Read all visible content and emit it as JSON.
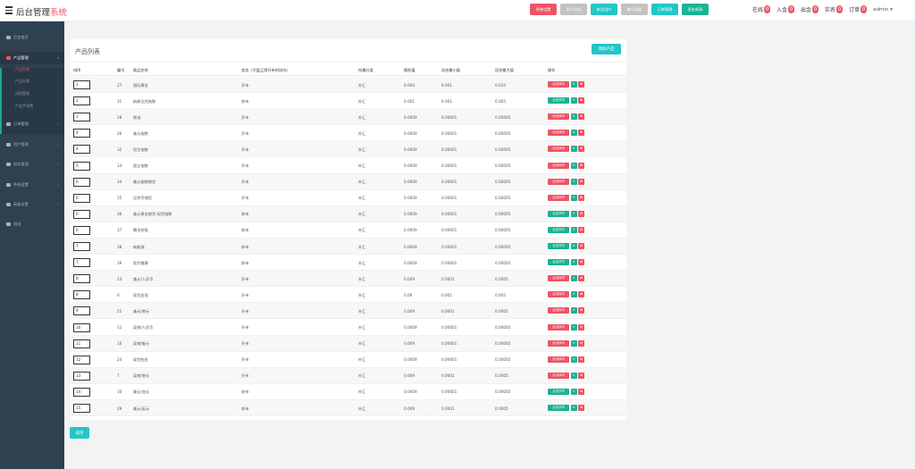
{
  "header": {
    "brand_main": "后台管理",
    "brand_accent": "系统",
    "buttons": [
      {
        "label": "系统设置",
        "color": "#ed5565"
      },
      {
        "label": "用户列表",
        "color": "#c2c2c2"
      },
      {
        "label": "新注用户",
        "color": "#23c6c8"
      },
      {
        "label": "账号出款",
        "color": "#c2c2c2"
      },
      {
        "label": "订单管理",
        "color": "#23c6c8"
      },
      {
        "label": "资金报表",
        "color": "#1ab394"
      }
    ],
    "stats": [
      {
        "label": "在线",
        "count": "0"
      },
      {
        "label": "入金",
        "count": "0"
      },
      {
        "label": "出金",
        "count": "0"
      },
      {
        "label": "实名",
        "count": "0"
      },
      {
        "label": "订单",
        "count": "0"
      }
    ],
    "user": "admin"
  },
  "sidebar": {
    "items": [
      {
        "label": "后台首页"
      },
      {
        "label": "产品管理"
      },
      {
        "label": "订单管理"
      },
      {
        "label": "用户管理"
      },
      {
        "label": "财务管理"
      },
      {
        "label": "系统设置"
      },
      {
        "label": "高级设置"
      },
      {
        "label": "退出"
      }
    ],
    "subitems": [
      {
        "label": "产品列表"
      },
      {
        "label": "产品分类"
      },
      {
        "label": "风控管理"
      },
      {
        "label": "产品手续费"
      }
    ]
  },
  "panel": {
    "title": "产品列表",
    "add_label": "添加产品",
    "sort_label": "排序"
  },
  "table": {
    "headers": [
      "排序",
      "编号",
      "商品名称",
      "状态（大盘正常开市时间内）",
      "所属分类",
      "随机值",
      "风控最小值",
      "风控最大值",
      "操作"
    ],
    "toggle_open": "点击开市",
    "toggle_close": "点击休市",
    "rows": [
      {
        "sort": "1",
        "id": "27",
        "name": "国际黄金",
        "status": "开市",
        "category": "外汇",
        "rand": "0.004",
        "min": "0.001",
        "max": "0.010",
        "open": false
      },
      {
        "sort": "2",
        "id": "31",
        "name": "纳斯达克指数",
        "status": "休市",
        "category": "外汇",
        "rand": "0.001",
        "min": "0.001",
        "max": "0.005",
        "open": true
      },
      {
        "sort": "3",
        "id": "28",
        "name": "原油",
        "status": "开市",
        "category": "外汇",
        "rand": "0.0009",
        "min": "0.00001",
        "max": "0.00005",
        "open": false
      },
      {
        "sort": "4",
        "id": "26",
        "name": "美元指数",
        "status": "开市",
        "category": "外汇",
        "rand": "0.0009",
        "min": "0.00001",
        "max": "0.00005",
        "open": false
      },
      {
        "sort": "4",
        "id": "32",
        "name": "恒生指数",
        "status": "开市",
        "category": "外汇",
        "rand": "0.0009",
        "min": "0.00001",
        "max": "0.00005",
        "open": false
      },
      {
        "sort": "5",
        "id": "33",
        "name": "国企指数",
        "status": "开市",
        "category": "外汇",
        "rand": "0.0009",
        "min": "0.00001",
        "max": "0.00005",
        "open": false
      },
      {
        "sort": "6",
        "id": "34",
        "name": "美元指数期货",
        "status": "开市",
        "category": "外汇",
        "rand": "0.0009",
        "min": "0.00001",
        "max": "0.00005",
        "open": false
      },
      {
        "sort": "6",
        "id": "35",
        "name": "比特币期货",
        "status": "开市",
        "category": "外汇",
        "rand": "0.0009",
        "min": "0.00001",
        "max": "0.00005",
        "open": false
      },
      {
        "sort": "6",
        "id": "36",
        "name": "美元黄金期货-现货指数",
        "status": "休市",
        "category": "外汇",
        "rand": "0.0009",
        "min": "0.00001",
        "max": "0.00005",
        "open": true
      },
      {
        "sort": "6",
        "id": "37",
        "name": "腾讯控股",
        "status": "休市",
        "category": "外汇",
        "rand": "0.0009",
        "min": "0.00001",
        "max": "0.00005",
        "open": true
      },
      {
        "sort": "7",
        "id": "38",
        "name": "新能源",
        "status": "休市",
        "category": "外汇",
        "rand": "0.0009",
        "min": "0.00001",
        "max": "0.00005",
        "open": true
      },
      {
        "sort": "7",
        "id": "39",
        "name": "医疗健康",
        "status": "休市",
        "category": "外汇",
        "rand": "0.0009",
        "min": "0.00001",
        "max": "0.00005",
        "open": true
      },
      {
        "sort": "8",
        "id": "23",
        "name": "美元/人民币",
        "status": "开市",
        "category": "外汇",
        "rand": "0.009",
        "min": "0.0001",
        "max": "0.0005",
        "open": false
      },
      {
        "sort": "8",
        "id": "6",
        "name": "现货白银",
        "status": "开市",
        "category": "外汇",
        "rand": "0.09",
        "min": "0.001",
        "max": "0.005",
        "open": false
      },
      {
        "sort": "9",
        "id": "25",
        "name": "美元/港元",
        "status": "开市",
        "category": "外汇",
        "rand": "0.009",
        "min": "0.0001",
        "max": "0.0005",
        "open": false
      },
      {
        "sort": "10",
        "id": "11",
        "name": "英镑/人民币",
        "status": "开市",
        "category": "外汇",
        "rand": "0.0009",
        "min": "0.00001",
        "max": "0.00005",
        "open": false
      },
      {
        "sort": "11",
        "id": "10",
        "name": "英镑/美元",
        "status": "开市",
        "category": "外汇",
        "rand": "0.009",
        "min": "0.00001",
        "max": "0.00005",
        "open": false
      },
      {
        "sort": "12",
        "id": "24",
        "name": "现货铂金",
        "status": "开市",
        "category": "外汇",
        "rand": "0.0009",
        "min": "0.00001",
        "max": "0.00005",
        "open": false
      },
      {
        "sort": "13",
        "id": "7",
        "name": "英镑/港元",
        "status": "开市",
        "category": "外汇",
        "rand": "0.009",
        "min": "0.0001",
        "max": "0.0005",
        "open": false
      },
      {
        "sort": "14",
        "id": "30",
        "name": "美元/加元",
        "status": "休市",
        "category": "外汇",
        "rand": "0.0009",
        "min": "0.00001",
        "max": "0.00005",
        "open": true
      },
      {
        "sort": "15",
        "id": "29",
        "name": "美元/英元",
        "status": "休市",
        "category": "外汇",
        "rand": "0.009",
        "min": "0.0001",
        "max": "0.0005",
        "open": true
      }
    ]
  }
}
